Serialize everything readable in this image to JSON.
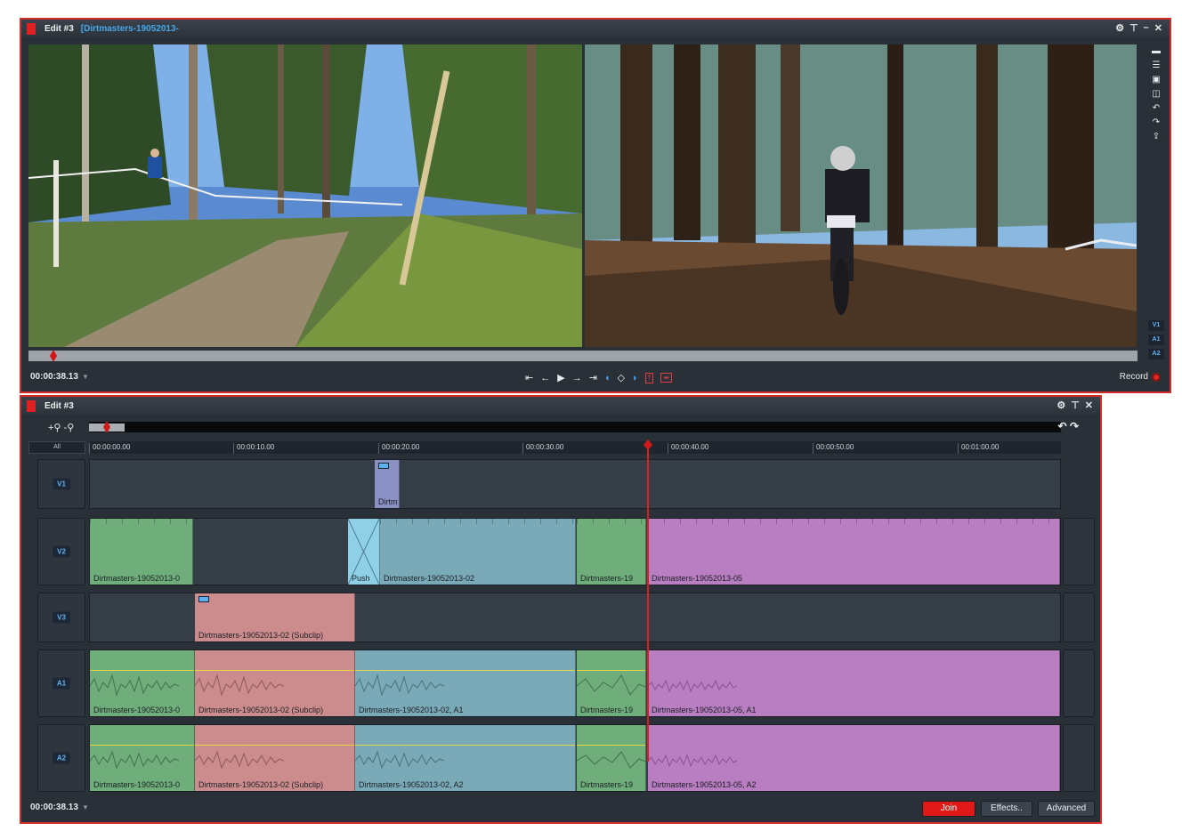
{
  "viewer": {
    "edit_label": "Edit #3",
    "clip_title": "[Dirtmasters-19052013-",
    "timecode": "00:00:38.13",
    "record_label": "Record",
    "track_tags": [
      "V1",
      "A1",
      "A2"
    ]
  },
  "timeline": {
    "edit_label": "Edit #3",
    "all_label": "All",
    "timecode": "00:00:38.13",
    "ruler": [
      "00:00:00.00",
      "00:00:10.00",
      "00:00:20.00",
      "00:00:30.00",
      "00:00:40.00",
      "00:00:50.00",
      "00:01:00.00"
    ],
    "tracks": [
      {
        "id": "V1",
        "clips": [
          {
            "name": "Dirtm",
            "color": "slate"
          }
        ]
      },
      {
        "id": "V2",
        "clips": [
          {
            "name": "Dirtmasters-19052013-0",
            "color": "green"
          },
          {
            "name": "Push",
            "color": "cyan"
          },
          {
            "name": "Dirtmasters-19052013-02",
            "color": "teal"
          },
          {
            "name": "Dirtmasters-19",
            "color": "green"
          },
          {
            "name": "Dirtmasters-19052013-05",
            "color": "purple"
          }
        ]
      },
      {
        "id": "V3",
        "clips": [
          {
            "name": "Dirtmasters-19052013-02 (Subclip)",
            "color": "pink"
          }
        ]
      },
      {
        "id": "A1",
        "clips": [
          {
            "name": "Dirtmasters-19052013-0",
            "color": "green"
          },
          {
            "name": "Dirtmasters-19052013-02 (Subclip)",
            "color": "pink"
          },
          {
            "name": "Dirtmasters-19052013-02, A1",
            "color": "teal"
          },
          {
            "name": "Dirtmasters-19",
            "color": "green"
          },
          {
            "name": "Dirtmasters-19052013-05, A1",
            "color": "purple"
          }
        ]
      },
      {
        "id": "A2",
        "clips": [
          {
            "name": "Dirtmasters-19052013-0",
            "color": "green"
          },
          {
            "name": "Dirtmasters-19052013-02 (Subclip)",
            "color": "pink"
          },
          {
            "name": "Dirtmasters-19052013-02, A2",
            "color": "teal"
          },
          {
            "name": "Dirtmasters-19",
            "color": "green"
          },
          {
            "name": "Dirtmasters-19052013-05, A2",
            "color": "purple"
          }
        ]
      }
    ],
    "buttons": {
      "join": "Join",
      "effects": "Effects..",
      "advanced": "Advanced"
    }
  },
  "icons": [
    "flag-icon",
    "settings-icon",
    "pin-icon",
    "minimize-icon",
    "close-icon",
    "go-to-start-icon",
    "step-back-icon",
    "play-icon",
    "step-forward-icon",
    "go-to-end-icon",
    "mark-in-icon",
    "mark-out-icon",
    "lift-icon",
    "extract-icon",
    "record-icon",
    "zoom-in-icon",
    "zoom-out-icon"
  ],
  "colors": {
    "accent_red": "#d42b2b",
    "accent_blue": "#48a8e8"
  }
}
